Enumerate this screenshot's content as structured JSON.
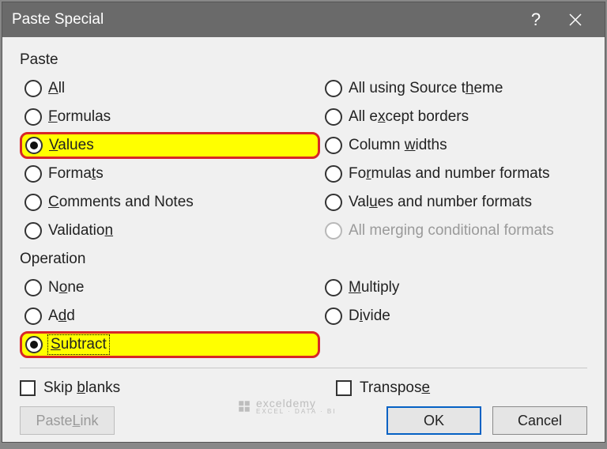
{
  "title": "Paste Special",
  "help_symbol": "?",
  "sections": {
    "paste": {
      "label": "Paste",
      "left": [
        {
          "id": "all",
          "pre": "",
          "u": "A",
          "post": "ll",
          "checked": false
        },
        {
          "id": "formulas",
          "pre": "",
          "u": "F",
          "post": "ormulas",
          "checked": false
        },
        {
          "id": "values",
          "pre": "",
          "u": "V",
          "post": "alues",
          "checked": true,
          "highlight": true
        },
        {
          "id": "formats",
          "pre": "Forma",
          "u": "t",
          "post": "s",
          "checked": false
        },
        {
          "id": "comments",
          "pre": "",
          "u": "C",
          "post": "omments and Notes",
          "checked": false
        },
        {
          "id": "validation",
          "pre": "Validatio",
          "u": "n",
          "post": "",
          "checked": false
        }
      ],
      "right": [
        {
          "id": "source_theme",
          "pre": "All using Source t",
          "u": "h",
          "post": "eme",
          "checked": false
        },
        {
          "id": "except_borders",
          "pre": "All e",
          "u": "x",
          "post": "cept borders",
          "checked": false
        },
        {
          "id": "col_widths",
          "pre": "Column ",
          "u": "w",
          "post": "idths",
          "checked": false
        },
        {
          "id": "formulas_num",
          "pre": "Fo",
          "u": "r",
          "post": "mulas and number formats",
          "checked": false
        },
        {
          "id": "values_num",
          "pre": "Val",
          "u": "u",
          "post": "es and number formats",
          "checked": false
        },
        {
          "id": "merge_cond",
          "pre": "All mer",
          "u": "g",
          "post": "ing conditional formats",
          "checked": false,
          "disabled": true
        }
      ]
    },
    "operation": {
      "label": "Operation",
      "left": [
        {
          "id": "none",
          "pre": "N",
          "u": "o",
          "post": "ne",
          "checked": false
        },
        {
          "id": "add",
          "pre": "A",
          "u": "d",
          "post": "d",
          "checked": false
        },
        {
          "id": "subtract",
          "pre": "",
          "u": "S",
          "post": "ubtract",
          "checked": true,
          "highlight": true,
          "focus": true
        }
      ],
      "right": [
        {
          "id": "multiply",
          "pre": "",
          "u": "M",
          "post": "ultiply",
          "checked": false
        },
        {
          "id": "divide",
          "pre": "D",
          "u": "i",
          "post": "vide",
          "checked": false
        }
      ]
    }
  },
  "checks": {
    "skip_blanks": {
      "pre": "Skip ",
      "u": "b",
      "post": "lanks",
      "checked": false
    },
    "transpose": {
      "pre": "Transpos",
      "u": "e",
      "post": "",
      "checked": false
    }
  },
  "buttons": {
    "paste_link": {
      "pre": "Paste ",
      "u": "L",
      "post": "ink",
      "disabled": true
    },
    "ok": "OK",
    "cancel": "Cancel"
  },
  "watermark": {
    "brand": "exceldemy",
    "sub": "EXCEL · DATA · BI"
  }
}
